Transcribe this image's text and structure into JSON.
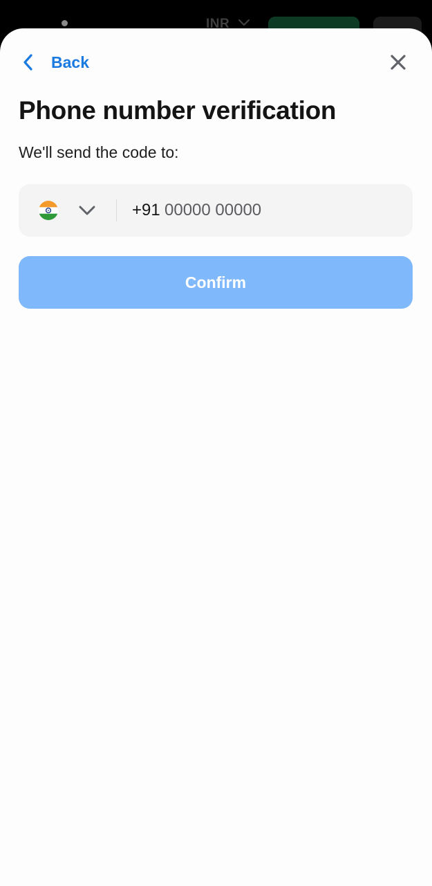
{
  "background": {
    "currency_label": "INR",
    "colors": {
      "overlay": "#000000",
      "deposit_button": "#0d3a22"
    }
  },
  "sheet": {
    "back_label": "Back",
    "title": "Phone number verification",
    "subtitle": "We'll send the code to:",
    "phone": {
      "country_flag": "india-flag-icon",
      "dial_code": "+91",
      "placeholder": "00000 00000",
      "value": ""
    },
    "confirm_label": "Confirm",
    "colors": {
      "accent": "#1a7ae0",
      "confirm_disabled": "#7fb9fb",
      "field_bg": "#f4f4f5"
    }
  }
}
